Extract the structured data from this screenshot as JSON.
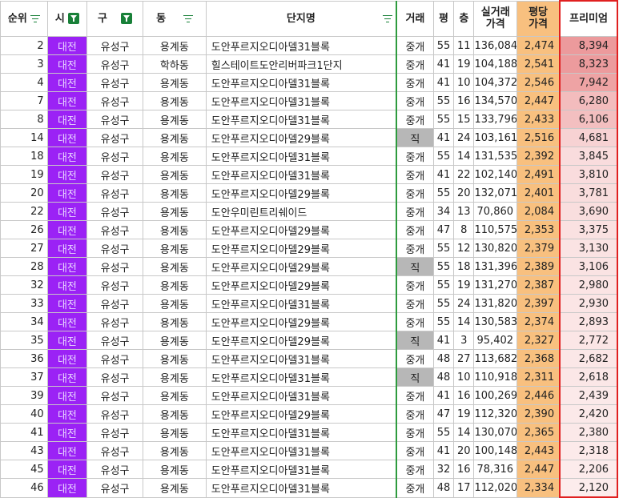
{
  "headers": {
    "rank": "순위",
    "city": "시",
    "district": "구",
    "dong": "동",
    "complex": "단지명",
    "deal": "거래",
    "area": "평",
    "floor": "층",
    "real_price": "실거래\n가격",
    "unit_price": "평당\n가격",
    "premium": "프리미엄"
  },
  "colors": {
    "city_bg": "#9b22f5",
    "unit_price_bg": "#f8c07f",
    "direct_bg": "#b7b7b7",
    "premium_border": "#e02020",
    "filter_green": "#188038"
  },
  "rows": [
    {
      "rank": "2",
      "city": "대전",
      "district": "유성구",
      "dong": "용계동",
      "complex": "도안푸르지오디아델31블록",
      "deal": "중개",
      "area": "55",
      "floor": "11",
      "real_price": "136,084",
      "unit_price": "2,474",
      "premium": "8,394",
      "premium_color": "#ec9a9c"
    },
    {
      "rank": "3",
      "city": "대전",
      "district": "유성구",
      "dong": "학하동",
      "complex": "힐스테이트도안리버파크1단지",
      "deal": "중개",
      "area": "41",
      "floor": "19",
      "real_price": "104,188",
      "unit_price": "2,541",
      "premium": "8,323",
      "premium_color": "#ec9b9d"
    },
    {
      "rank": "4",
      "city": "대전",
      "district": "유성구",
      "dong": "용계동",
      "complex": "도안푸르지오디아델31블록",
      "deal": "중개",
      "area": "41",
      "floor": "10",
      "real_price": "104,372",
      "unit_price": "2,546",
      "premium": "7,942",
      "premium_color": "#eea3a4"
    },
    {
      "rank": "7",
      "city": "대전",
      "district": "유성구",
      "dong": "용계동",
      "complex": "도안푸르지오디아델31블록",
      "deal": "중개",
      "area": "55",
      "floor": "16",
      "real_price": "134,570",
      "unit_price": "2,447",
      "premium": "6,280",
      "premium_color": "#f3bcbd"
    },
    {
      "rank": "8",
      "city": "대전",
      "district": "유성구",
      "dong": "용계동",
      "complex": "도안푸르지오디아델31블록",
      "deal": "중개",
      "area": "55",
      "floor": "15",
      "real_price": "133,796",
      "unit_price": "2,433",
      "premium": "6,106",
      "premium_color": "#f3bfc0"
    },
    {
      "rank": "14",
      "city": "대전",
      "district": "유성구",
      "dong": "용계동",
      "complex": "도안푸르지오디아델29블록",
      "deal": "직",
      "area": "41",
      "floor": "24",
      "real_price": "103,161",
      "unit_price": "2,516",
      "premium": "4,681",
      "premium_color": "#f7d2d3"
    },
    {
      "rank": "18",
      "city": "대전",
      "district": "유성구",
      "dong": "용계동",
      "complex": "도안푸르지오디아델31블록",
      "deal": "중개",
      "area": "55",
      "floor": "14",
      "real_price": "131,535",
      "unit_price": "2,392",
      "premium": "3,845",
      "premium_color": "#f9dcdd"
    },
    {
      "rank": "19",
      "city": "대전",
      "district": "유성구",
      "dong": "용계동",
      "complex": "도안푸르지오디아델31블록",
      "deal": "중개",
      "area": "41",
      "floor": "22",
      "real_price": "102,140",
      "unit_price": "2,491",
      "premium": "3,810",
      "premium_color": "#f9dcdd"
    },
    {
      "rank": "20",
      "city": "대전",
      "district": "유성구",
      "dong": "용계동",
      "complex": "도안푸르지오디아델29블록",
      "deal": "중개",
      "area": "55",
      "floor": "20",
      "real_price": "132,071",
      "unit_price": "2,401",
      "premium": "3,781",
      "premium_color": "#f9dddd"
    },
    {
      "rank": "22",
      "city": "대전",
      "district": "유성구",
      "dong": "용계동",
      "complex": "도안우미린트리쉐이드",
      "deal": "중개",
      "area": "34",
      "floor": "13",
      "real_price": "70,860",
      "unit_price": "2,084",
      "premium": "3,690",
      "premium_color": "#f9dede"
    },
    {
      "rank": "26",
      "city": "대전",
      "district": "유성구",
      "dong": "용계동",
      "complex": "도안푸르지오디아델29블록",
      "deal": "중개",
      "area": "47",
      "floor": "8",
      "real_price": "110,575",
      "unit_price": "2,353",
      "premium": "3,375",
      "premium_color": "#fae1e1"
    },
    {
      "rank": "27",
      "city": "대전",
      "district": "유성구",
      "dong": "용계동",
      "complex": "도안푸르지오디아델29블록",
      "deal": "중개",
      "area": "55",
      "floor": "12",
      "real_price": "130,820",
      "unit_price": "2,379",
      "premium": "3,130",
      "premium_color": "#fae3e3"
    },
    {
      "rank": "28",
      "city": "대전",
      "district": "유성구",
      "dong": "용계동",
      "complex": "도안푸르지오디아델29블록",
      "deal": "직",
      "area": "55",
      "floor": "18",
      "real_price": "131,396",
      "unit_price": "2,389",
      "premium": "3,106",
      "premium_color": "#fae3e3"
    },
    {
      "rank": "32",
      "city": "대전",
      "district": "유성구",
      "dong": "용계동",
      "complex": "도안푸르지오디아델29블록",
      "deal": "중개",
      "area": "55",
      "floor": "19",
      "real_price": "131,270",
      "unit_price": "2,387",
      "premium": "2,980",
      "premium_color": "#fbe4e4"
    },
    {
      "rank": "33",
      "city": "대전",
      "district": "유성구",
      "dong": "용계동",
      "complex": "도안푸르지오디아델31블록",
      "deal": "중개",
      "area": "55",
      "floor": "24",
      "real_price": "131,820",
      "unit_price": "2,397",
      "premium": "2,930",
      "premium_color": "#fbe5e5"
    },
    {
      "rank": "34",
      "city": "대전",
      "district": "유성구",
      "dong": "용계동",
      "complex": "도안푸르지오디아델29블록",
      "deal": "중개",
      "area": "55",
      "floor": "14",
      "real_price": "130,583",
      "unit_price": "2,374",
      "premium": "2,893",
      "premium_color": "#fbe5e5"
    },
    {
      "rank": "35",
      "city": "대전",
      "district": "유성구",
      "dong": "용계동",
      "complex": "도안푸르지오디아델29블록",
      "deal": "직",
      "area": "41",
      "floor": "3",
      "real_price": "95,402",
      "unit_price": "2,327",
      "premium": "2,772",
      "premium_color": "#fbe6e6"
    },
    {
      "rank": "36",
      "city": "대전",
      "district": "유성구",
      "dong": "용계동",
      "complex": "도안푸르지오디아델31블록",
      "deal": "중개",
      "area": "48",
      "floor": "27",
      "real_price": "113,682",
      "unit_price": "2,368",
      "premium": "2,682",
      "premium_color": "#fbe7e7"
    },
    {
      "rank": "37",
      "city": "대전",
      "district": "유성구",
      "dong": "용계동",
      "complex": "도안푸르지오디아델31블록",
      "deal": "직",
      "area": "48",
      "floor": "10",
      "real_price": "110,918",
      "unit_price": "2,311",
      "premium": "2,618",
      "premium_color": "#fbe7e7"
    },
    {
      "rank": "39",
      "city": "대전",
      "district": "유성구",
      "dong": "용계동",
      "complex": "도안푸르지오디아델31블록",
      "deal": "중개",
      "area": "41",
      "floor": "16",
      "real_price": "100,269",
      "unit_price": "2,446",
      "premium": "2,439",
      "premium_color": "#fbe9e9"
    },
    {
      "rank": "40",
      "city": "대전",
      "district": "유성구",
      "dong": "용계동",
      "complex": "도안푸르지오디아델29블록",
      "deal": "중개",
      "area": "47",
      "floor": "19",
      "real_price": "112,320",
      "unit_price": "2,390",
      "premium": "2,420",
      "premium_color": "#fbe9e9"
    },
    {
      "rank": "41",
      "city": "대전",
      "district": "유성구",
      "dong": "용계동",
      "complex": "도안푸르지오디아델31블록",
      "deal": "중개",
      "area": "55",
      "floor": "14",
      "real_price": "130,070",
      "unit_price": "2,365",
      "premium": "2,380",
      "premium_color": "#fbe9e9"
    },
    {
      "rank": "43",
      "city": "대전",
      "district": "유성구",
      "dong": "용계동",
      "complex": "도안푸르지오디아델31블록",
      "deal": "중개",
      "area": "41",
      "floor": "20",
      "real_price": "100,148",
      "unit_price": "2,443",
      "premium": "2,318",
      "premium_color": "#fceaea"
    },
    {
      "rank": "45",
      "city": "대전",
      "district": "유성구",
      "dong": "용계동",
      "complex": "도안푸르지오디아델31블록",
      "deal": "중개",
      "area": "32",
      "floor": "16",
      "real_price": "78,316",
      "unit_price": "2,447",
      "premium": "2,206",
      "premium_color": "#fcebeb"
    },
    {
      "rank": "46",
      "city": "대전",
      "district": "유성구",
      "dong": "용계동",
      "complex": "도안푸르지오디아델31블록",
      "deal": "중개",
      "area": "48",
      "floor": "17",
      "real_price": "112,020",
      "unit_price": "2,334",
      "premium": "2,120",
      "premium_color": "#fcecec"
    }
  ]
}
